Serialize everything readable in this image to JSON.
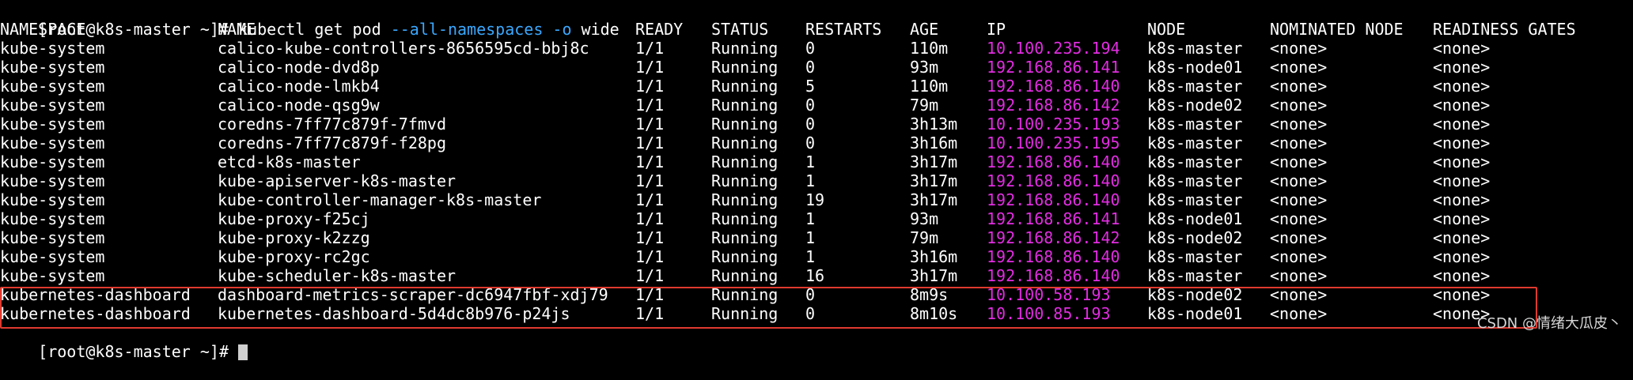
{
  "terminal": {
    "prompt": "[root@k8s-master ~]# ",
    "command_base": "kubectl get pod ",
    "command_opt1": "--all-namespaces",
    "command_sp": " ",
    "command_opt2": "-o",
    "command_tail": " wide",
    "final_prompt": "[root@k8s-master ~]# ",
    "headers": {
      "namespace": "NAMESPACE",
      "name": "NAME",
      "ready": "READY",
      "status": "STATUS",
      "restarts": "RESTARTS",
      "age": "AGE",
      "ip": "IP",
      "node": "NODE",
      "nominated": "NOMINATED NODE",
      "readiness": "READINESS GATES"
    },
    "rows": [
      {
        "namespace": "kube-system",
        "name": "calico-kube-controllers-8656595cd-bbj8c",
        "ready": "1/1",
        "status": "Running",
        "restarts": "0",
        "age": "110m",
        "ip": "10.100.235.194",
        "node": "k8s-master",
        "nominated": "<none>",
        "readiness": "<none>"
      },
      {
        "namespace": "kube-system",
        "name": "calico-node-dvd8p",
        "ready": "1/1",
        "status": "Running",
        "restarts": "0",
        "age": "93m",
        "ip": "192.168.86.141",
        "node": "k8s-node01",
        "nominated": "<none>",
        "readiness": "<none>"
      },
      {
        "namespace": "kube-system",
        "name": "calico-node-lmkb4",
        "ready": "1/1",
        "status": "Running",
        "restarts": "5",
        "age": "110m",
        "ip": "192.168.86.140",
        "node": "k8s-master",
        "nominated": "<none>",
        "readiness": "<none>"
      },
      {
        "namespace": "kube-system",
        "name": "calico-node-qsg9w",
        "ready": "1/1",
        "status": "Running",
        "restarts": "0",
        "age": "79m",
        "ip": "192.168.86.142",
        "node": "k8s-node02",
        "nominated": "<none>",
        "readiness": "<none>"
      },
      {
        "namespace": "kube-system",
        "name": "coredns-7ff77c879f-7fmvd",
        "ready": "1/1",
        "status": "Running",
        "restarts": "0",
        "age": "3h13m",
        "ip": "10.100.235.193",
        "node": "k8s-master",
        "nominated": "<none>",
        "readiness": "<none>"
      },
      {
        "namespace": "kube-system",
        "name": "coredns-7ff77c879f-f28pg",
        "ready": "1/1",
        "status": "Running",
        "restarts": "0",
        "age": "3h16m",
        "ip": "10.100.235.195",
        "node": "k8s-master",
        "nominated": "<none>",
        "readiness": "<none>"
      },
      {
        "namespace": "kube-system",
        "name": "etcd-k8s-master",
        "ready": "1/1",
        "status": "Running",
        "restarts": "1",
        "age": "3h17m",
        "ip": "192.168.86.140",
        "node": "k8s-master",
        "nominated": "<none>",
        "readiness": "<none>"
      },
      {
        "namespace": "kube-system",
        "name": "kube-apiserver-k8s-master",
        "ready": "1/1",
        "status": "Running",
        "restarts": "1",
        "age": "3h17m",
        "ip": "192.168.86.140",
        "node": "k8s-master",
        "nominated": "<none>",
        "readiness": "<none>"
      },
      {
        "namespace": "kube-system",
        "name": "kube-controller-manager-k8s-master",
        "ready": "1/1",
        "status": "Running",
        "restarts": "19",
        "age": "3h17m",
        "ip": "192.168.86.140",
        "node": "k8s-master",
        "nominated": "<none>",
        "readiness": "<none>"
      },
      {
        "namespace": "kube-system",
        "name": "kube-proxy-f25cj",
        "ready": "1/1",
        "status": "Running",
        "restarts": "1",
        "age": "93m",
        "ip": "192.168.86.141",
        "node": "k8s-node01",
        "nominated": "<none>",
        "readiness": "<none>"
      },
      {
        "namespace": "kube-system",
        "name": "kube-proxy-k2zzg",
        "ready": "1/1",
        "status": "Running",
        "restarts": "1",
        "age": "79m",
        "ip": "192.168.86.142",
        "node": "k8s-node02",
        "nominated": "<none>",
        "readiness": "<none>"
      },
      {
        "namespace": "kube-system",
        "name": "kube-proxy-rc2gc",
        "ready": "1/1",
        "status": "Running",
        "restarts": "1",
        "age": "3h16m",
        "ip": "192.168.86.140",
        "node": "k8s-master",
        "nominated": "<none>",
        "readiness": "<none>"
      },
      {
        "namespace": "kube-system",
        "name": "kube-scheduler-k8s-master",
        "ready": "1/1",
        "status": "Running",
        "restarts": "16",
        "age": "3h17m",
        "ip": "192.168.86.140",
        "node": "k8s-master",
        "nominated": "<none>",
        "readiness": "<none>"
      },
      {
        "namespace": "kubernetes-dashboard",
        "name": "dashboard-metrics-scraper-dc6947fbf-xdj79",
        "ready": "1/1",
        "status": "Running",
        "restarts": "0",
        "age": "8m9s",
        "ip": "10.100.58.193",
        "node": "k8s-node02",
        "nominated": "<none>",
        "readiness": "<none>"
      },
      {
        "namespace": "kubernetes-dashboard",
        "name": "kubernetes-dashboard-5d4dc8b976-p24js",
        "ready": "1/1",
        "status": "Running",
        "restarts": "0",
        "age": "8m10s",
        "ip": "10.100.85.193",
        "node": "k8s-node01",
        "nominated": "<none>",
        "readiness": "<none>"
      }
    ]
  },
  "watermark": "CSDN @情绪大瓜皮丶",
  "colors": {
    "background": "#000000",
    "text": "#ffffff",
    "option_flag": "#3aa8ff",
    "ip_address": "#e22ce2",
    "highlight_border": "#e03a2f"
  }
}
